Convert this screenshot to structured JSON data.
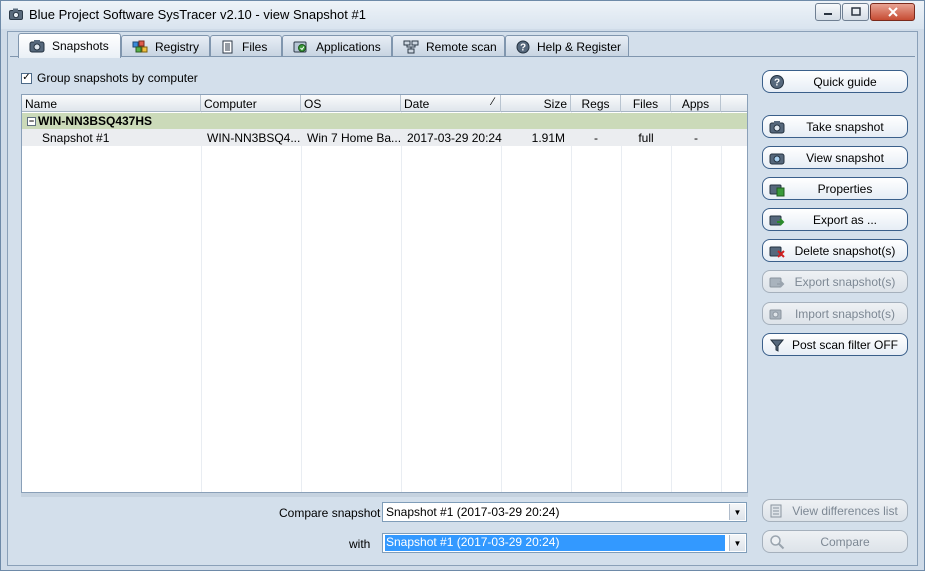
{
  "window": {
    "title": "Blue Project Software SysTracer v2.10 - view Snapshot #1"
  },
  "tabs": [
    {
      "label": "Snapshots",
      "icon": "camera-icon",
      "active": true
    },
    {
      "label": "Registry",
      "icon": "registry-icon",
      "active": false
    },
    {
      "label": "Files",
      "icon": "files-icon",
      "active": false
    },
    {
      "label": "Applications",
      "icon": "applications-icon",
      "active": false
    },
    {
      "label": "Remote scan",
      "icon": "network-icon",
      "active": false
    },
    {
      "label": "Help & Register",
      "icon": "help-icon",
      "active": false
    }
  ],
  "group_by_computer": {
    "label": "Group snapshots by computer",
    "checked": true
  },
  "grid": {
    "columns": [
      "Name",
      "Computer",
      "OS",
      "Date",
      "Size",
      "Regs",
      "Files",
      "Apps"
    ],
    "groups": [
      {
        "name": "WIN-NN3BSQ437HS",
        "rows": [
          {
            "name": "Snapshot #1",
            "computer": "WIN-NN3BSQ4...",
            "os": "Win 7 Home Ba...",
            "date": "2017-03-29 20:24",
            "size": "1.91M",
            "regs": "-",
            "files": "full",
            "apps": "-"
          }
        ]
      }
    ]
  },
  "compare": {
    "label": "Compare snapshot",
    "value": "Snapshot #1 (2017-03-29 20:24)",
    "with_label": "with",
    "with_value": "Snapshot #1 (2017-03-29 20:24)"
  },
  "buttons": {
    "quick_guide": "Quick guide",
    "take_snapshot": "Take snapshot",
    "view_snapshot": "View snapshot",
    "properties": "Properties",
    "export_as": "Export as ...",
    "delete_snapshots": "Delete snapshot(s)",
    "export_snapshots": "Export snapshot(s)",
    "import_snapshots": "Import snapshot(s)",
    "post_scan_filter": "Post scan filter OFF",
    "view_differences": "View differences list",
    "compare": "Compare"
  },
  "colors": {
    "window_bg": "#d3dfeb",
    "group_row": "#cbdab9",
    "selection": "#3399ff",
    "button_border": "#3a5f8a"
  }
}
